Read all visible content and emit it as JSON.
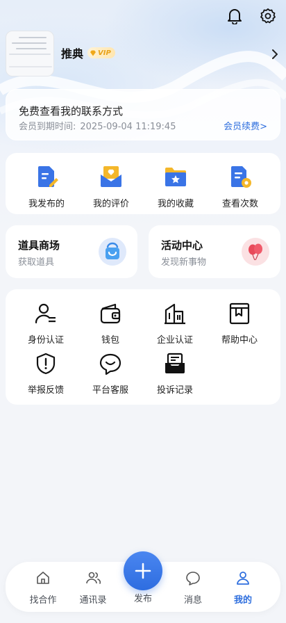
{
  "profile": {
    "nickname": "推典",
    "vip_badge": "VIP"
  },
  "member": {
    "title": "免费查看我的联系方式",
    "expire_label": "会员到期时间:",
    "expire_time": "2025-09-04 11:19:45",
    "renew_label": "会员续费>"
  },
  "quick": {
    "items": [
      {
        "label": "我发布的",
        "icon": "document-edit-icon"
      },
      {
        "label": "我的评价",
        "icon": "rating-envelope-icon"
      },
      {
        "label": "我的收藏",
        "icon": "star-folder-icon"
      },
      {
        "label": "查看次数",
        "icon": "view-count-icon"
      }
    ]
  },
  "promo": {
    "shop_title": "道具商场",
    "shop_sub": "获取道具",
    "activity_title": "活动中心",
    "activity_sub": "发现新事物"
  },
  "services": {
    "items": [
      {
        "label": "身份认证",
        "icon": "identity-icon"
      },
      {
        "label": "钱包",
        "icon": "wallet-icon"
      },
      {
        "label": "企业认证",
        "icon": "enterprise-icon"
      },
      {
        "label": "帮助中心",
        "icon": "help-book-icon"
      },
      {
        "label": "举报反馈",
        "icon": "report-shield-icon"
      },
      {
        "label": "平台客服",
        "icon": "customer-service-icon"
      },
      {
        "label": "投诉记录",
        "icon": "complaint-record-icon"
      }
    ]
  },
  "tabbar": {
    "items": [
      {
        "label": "找合作",
        "icon": "home-icon"
      },
      {
        "label": "通讯录",
        "icon": "contacts-icon"
      },
      {
        "label": "发布",
        "icon": "plus-icon"
      },
      {
        "label": "消息",
        "icon": "message-icon"
      },
      {
        "label": "我的",
        "icon": "profile-icon"
      }
    ],
    "active_color": "#2f6fde"
  },
  "colors": {
    "accent": "#2f6fde",
    "vip": "#e8a21a",
    "background": "#f3f5f9"
  }
}
